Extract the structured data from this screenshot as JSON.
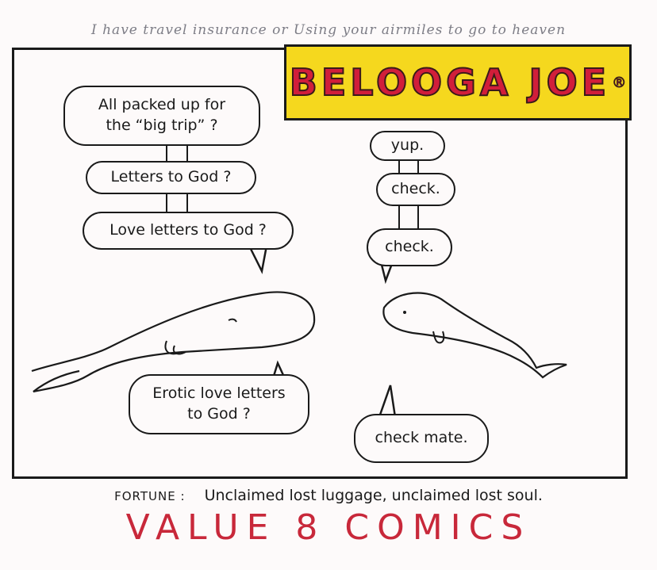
{
  "subtitle": "I have travel insurance or Using your airmiles to go to heaven",
  "title": "BELOOGA JOE",
  "title_mark": "®",
  "colors": {
    "title_bg": "#f5d81e",
    "title_text": "#d11e3a",
    "footer_text": "#c8283a"
  },
  "bubbles": {
    "left1": "All packed up for\nthe “big trip” ?",
    "left2": "Letters to God ?",
    "left3": "Love letters to God ?",
    "left4": "Erotic love letters\nto God ?",
    "right1": "yup.",
    "right2": "check.",
    "right3": "check.",
    "right4": "check mate."
  },
  "fortune_label": "FORTUNE :",
  "fortune_text": "Unclaimed lost luggage, unclaimed lost soul.",
  "footer": "VALUE 8 COMICS"
}
